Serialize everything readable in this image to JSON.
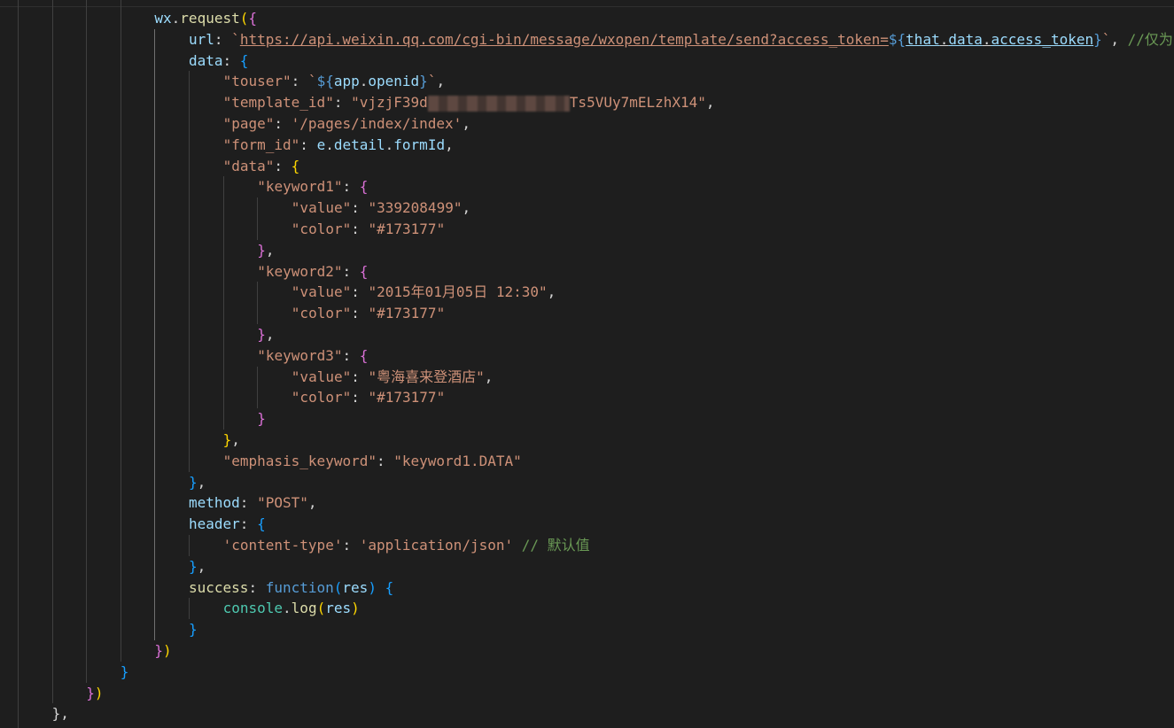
{
  "editor": {
    "language": "javascript",
    "theme_colors": {
      "background": "#1e1e1e",
      "property": "#9cdcfe",
      "string": "#ce9178",
      "comment": "#6a9955",
      "keyword": "#569cd6",
      "function": "#dcdcaa",
      "class": "#4ec9b0",
      "bracket_level_1": "#ffd700",
      "bracket_level_2": "#da70d6",
      "bracket_level_3": "#179fff"
    },
    "lines": [
      {
        "indent": 4,
        "tokens": [
          {
            "t": "var",
            "v": "wx"
          },
          {
            "t": "punc",
            "v": "."
          },
          {
            "t": "fn",
            "v": "request"
          },
          {
            "t": "b1",
            "v": "("
          },
          {
            "t": "b2",
            "v": "{"
          }
        ]
      },
      {
        "indent": 5,
        "tokens": [
          {
            "t": "key",
            "v": "url"
          },
          {
            "t": "punc",
            "v": ": "
          },
          {
            "t": "str",
            "v": "`"
          },
          {
            "t": "url",
            "v": "https://api.weixin.qq.com/cgi-bin/message/wxopen/template/send?access_token="
          },
          {
            "t": "tpl",
            "v": "${"
          },
          {
            "t": "var-ul",
            "v": "that"
          },
          {
            "t": "punc-ul",
            "v": "."
          },
          {
            "t": "var-ul",
            "v": "data"
          },
          {
            "t": "punc-ul",
            "v": "."
          },
          {
            "t": "var-ul",
            "v": "access_token"
          },
          {
            "t": "tpl",
            "v": "}"
          },
          {
            "t": "str",
            "v": "`"
          },
          {
            "t": "punc",
            "v": ", "
          },
          {
            "t": "cmt",
            "v": "//仅为"
          }
        ]
      },
      {
        "indent": 5,
        "tokens": [
          {
            "t": "key",
            "v": "data"
          },
          {
            "t": "punc",
            "v": ": "
          },
          {
            "t": "b3",
            "v": "{"
          }
        ]
      },
      {
        "indent": 6,
        "tokens": [
          {
            "t": "str",
            "v": "\"touser\""
          },
          {
            "t": "punc",
            "v": ": "
          },
          {
            "t": "str",
            "v": "`"
          },
          {
            "t": "tpl",
            "v": "${"
          },
          {
            "t": "var",
            "v": "app"
          },
          {
            "t": "punc",
            "v": "."
          },
          {
            "t": "var",
            "v": "openid"
          },
          {
            "t": "tpl",
            "v": "}"
          },
          {
            "t": "str",
            "v": "`"
          },
          {
            "t": "punc",
            "v": ","
          }
        ]
      },
      {
        "indent": 6,
        "tokens": [
          {
            "t": "str",
            "v": "\"template_id\""
          },
          {
            "t": "punc",
            "v": ": "
          },
          {
            "t": "str",
            "v": "\"vjzjF39d"
          },
          {
            "t": "blur",
            "v": ""
          },
          {
            "t": "str",
            "v": "Ts5VUy7mELzhX14\""
          },
          {
            "t": "punc",
            "v": ","
          }
        ]
      },
      {
        "indent": 6,
        "tokens": [
          {
            "t": "str",
            "v": "\"page\""
          },
          {
            "t": "punc",
            "v": ": "
          },
          {
            "t": "str",
            "v": "'/pages/index/index'"
          },
          {
            "t": "punc",
            "v": ","
          }
        ]
      },
      {
        "indent": 6,
        "tokens": [
          {
            "t": "str",
            "v": "\"form_id\""
          },
          {
            "t": "punc",
            "v": ": "
          },
          {
            "t": "var",
            "v": "e"
          },
          {
            "t": "punc",
            "v": "."
          },
          {
            "t": "var",
            "v": "detail"
          },
          {
            "t": "punc",
            "v": "."
          },
          {
            "t": "var",
            "v": "formId"
          },
          {
            "t": "punc",
            "v": ","
          }
        ]
      },
      {
        "indent": 6,
        "tokens": [
          {
            "t": "str",
            "v": "\"data\""
          },
          {
            "t": "punc",
            "v": ": "
          },
          {
            "t": "b1",
            "v": "{"
          }
        ]
      },
      {
        "indent": 7,
        "tokens": [
          {
            "t": "str",
            "v": "\"keyword1\""
          },
          {
            "t": "punc",
            "v": ": "
          },
          {
            "t": "b2",
            "v": "{"
          }
        ]
      },
      {
        "indent": 8,
        "tokens": [
          {
            "t": "str",
            "v": "\"value\""
          },
          {
            "t": "punc",
            "v": ": "
          },
          {
            "t": "str",
            "v": "\"339208499\""
          },
          {
            "t": "punc",
            "v": ","
          }
        ]
      },
      {
        "indent": 8,
        "tokens": [
          {
            "t": "str",
            "v": "\"color\""
          },
          {
            "t": "punc",
            "v": ": "
          },
          {
            "t": "str",
            "v": "\"#173177\""
          }
        ]
      },
      {
        "indent": 7,
        "tokens": [
          {
            "t": "b2",
            "v": "}"
          },
          {
            "t": "punc",
            "v": ","
          }
        ]
      },
      {
        "indent": 7,
        "tokens": [
          {
            "t": "str",
            "v": "\"keyword2\""
          },
          {
            "t": "punc",
            "v": ": "
          },
          {
            "t": "b2",
            "v": "{"
          }
        ]
      },
      {
        "indent": 8,
        "tokens": [
          {
            "t": "str",
            "v": "\"value\""
          },
          {
            "t": "punc",
            "v": ": "
          },
          {
            "t": "str",
            "v": "\"2015年01月05日 12:30\""
          },
          {
            "t": "punc",
            "v": ","
          }
        ]
      },
      {
        "indent": 8,
        "tokens": [
          {
            "t": "str",
            "v": "\"color\""
          },
          {
            "t": "punc",
            "v": ": "
          },
          {
            "t": "str",
            "v": "\"#173177\""
          }
        ]
      },
      {
        "indent": 7,
        "tokens": [
          {
            "t": "b2",
            "v": "}"
          },
          {
            "t": "punc",
            "v": ","
          }
        ]
      },
      {
        "indent": 7,
        "tokens": [
          {
            "t": "str",
            "v": "\"keyword3\""
          },
          {
            "t": "punc",
            "v": ": "
          },
          {
            "t": "b2",
            "v": "{"
          }
        ]
      },
      {
        "indent": 8,
        "tokens": [
          {
            "t": "str",
            "v": "\"value\""
          },
          {
            "t": "punc",
            "v": ": "
          },
          {
            "t": "str",
            "v": "\"粤海喜来登酒店\""
          },
          {
            "t": "punc",
            "v": ","
          }
        ]
      },
      {
        "indent": 8,
        "tokens": [
          {
            "t": "str",
            "v": "\"color\""
          },
          {
            "t": "punc",
            "v": ": "
          },
          {
            "t": "str",
            "v": "\"#173177\""
          }
        ]
      },
      {
        "indent": 7,
        "tokens": [
          {
            "t": "b2",
            "v": "}"
          }
        ]
      },
      {
        "indent": 6,
        "tokens": [
          {
            "t": "b1",
            "v": "}"
          },
          {
            "t": "punc",
            "v": ","
          }
        ]
      },
      {
        "indent": 6,
        "tokens": [
          {
            "t": "str",
            "v": "\"emphasis_keyword\""
          },
          {
            "t": "punc",
            "v": ": "
          },
          {
            "t": "str",
            "v": "\"keyword1.DATA\""
          }
        ]
      },
      {
        "indent": 5,
        "tokens": [
          {
            "t": "b3",
            "v": "}"
          },
          {
            "t": "punc",
            "v": ","
          }
        ]
      },
      {
        "indent": 5,
        "tokens": [
          {
            "t": "key",
            "v": "method"
          },
          {
            "t": "punc",
            "v": ": "
          },
          {
            "t": "str",
            "v": "\"POST\""
          },
          {
            "t": "punc",
            "v": ","
          }
        ]
      },
      {
        "indent": 5,
        "tokens": [
          {
            "t": "key",
            "v": "header"
          },
          {
            "t": "punc",
            "v": ": "
          },
          {
            "t": "b3",
            "v": "{"
          }
        ]
      },
      {
        "indent": 6,
        "tokens": [
          {
            "t": "str",
            "v": "'content-type'"
          },
          {
            "t": "punc",
            "v": ": "
          },
          {
            "t": "str",
            "v": "'application/json'"
          },
          {
            "t": "punc",
            "v": " "
          },
          {
            "t": "cmt",
            "v": "// 默认值"
          }
        ]
      },
      {
        "indent": 5,
        "tokens": [
          {
            "t": "b3",
            "v": "}"
          },
          {
            "t": "punc",
            "v": ","
          }
        ]
      },
      {
        "indent": 5,
        "tokens": [
          {
            "t": "fn",
            "v": "success"
          },
          {
            "t": "punc",
            "v": ": "
          },
          {
            "t": "kw",
            "v": "function"
          },
          {
            "t": "b3",
            "v": "("
          },
          {
            "t": "var",
            "v": "res"
          },
          {
            "t": "b3",
            "v": ")"
          },
          {
            "t": "punc",
            "v": " "
          },
          {
            "t": "b3",
            "v": "{"
          }
        ]
      },
      {
        "indent": 6,
        "tokens": [
          {
            "t": "cls",
            "v": "console"
          },
          {
            "t": "punc",
            "v": "."
          },
          {
            "t": "fn",
            "v": "log"
          },
          {
            "t": "b1",
            "v": "("
          },
          {
            "t": "var",
            "v": "res"
          },
          {
            "t": "b1",
            "v": ")"
          }
        ]
      },
      {
        "indent": 5,
        "tokens": [
          {
            "t": "b3",
            "v": "}"
          }
        ]
      },
      {
        "indent": 4,
        "tokens": [
          {
            "t": "b2",
            "v": "}"
          },
          {
            "t": "b1",
            "v": ")"
          }
        ]
      },
      {
        "indent": 3,
        "tokens": [
          {
            "t": "b3",
            "v": "}"
          }
        ]
      },
      {
        "indent": 2,
        "tokens": [
          {
            "t": "b2",
            "v": "}"
          },
          {
            "t": "b1",
            "v": ")"
          }
        ]
      },
      {
        "indent": 1,
        "tokens": [
          {
            "t": "punc",
            "v": "},"
          }
        ]
      }
    ]
  }
}
